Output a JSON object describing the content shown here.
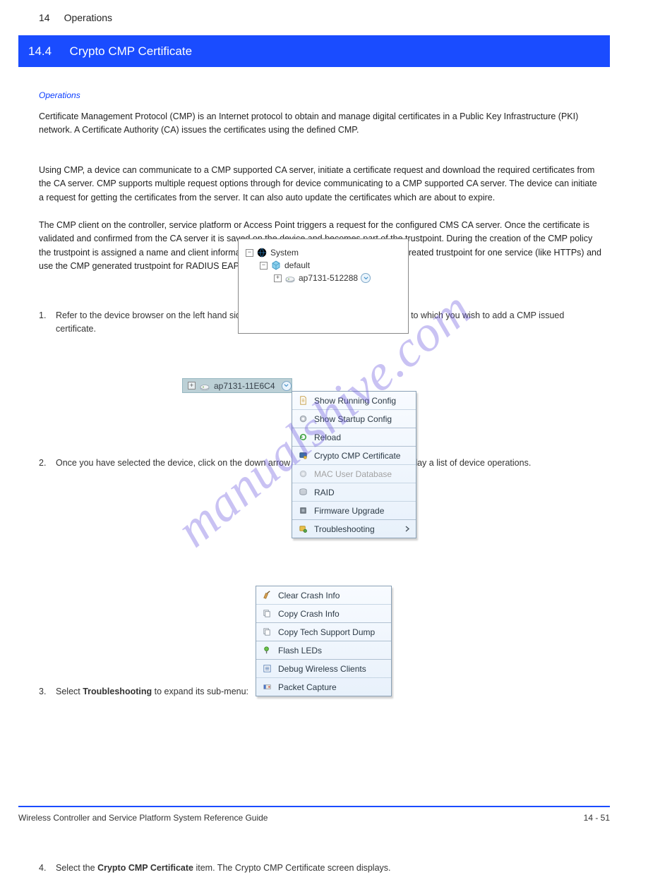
{
  "chapter": {
    "num": "14",
    "title": "Operations"
  },
  "section": {
    "num": "14.4",
    "title": "Crypto CMP Certificate",
    "parent_italic": "Operations"
  },
  "para1": "Certificate Management Protocol (CMP) is an Internet protocol to obtain and manage digital certificates in a Public Key Infrastructure (PKI) network. A Certificate Authority (CA) issues the certificates using the defined CMP.",
  "para2": "Using CMP, a device can communicate to a CMP supported CA server, initiate a certificate request and download the required certificates from the CA server. CMP supports multiple request options through for device communicating to a CMP supported CA server. The device can initiate a request for getting the certificates from the server. It can also auto update the certificates which are about to expire.",
  "steps_head": "The CMP client on the controller, service platform or Access Point triggers a request for the configured CMS CA server. Once the certificate is validated and confirmed from the CA server it is saved on the device and becomes part of the trustpoint. During the creation of the CMP policy the trustpoint is assigned a name and client information. An administrator can use a manually created trustpoint for one service (like HTTPs) and use the CMP generated trustpoint for RADIUS EAP certificate based authentication.",
  "steps": {
    "s1": "Refer to the device browser on the left hand side of the screen and drill down to the device to which you wish to add a CMP issued certificate.",
    "s2": "Once you have selected the device, click on the down arrow to the right of the device to display a list of device operations.",
    "s3_a": "Select ",
    "s3_b": "Troubleshooting",
    "s3_c": " to expand its sub-menu:",
    "s4_a": "Select the ",
    "s4_b": "Crypto CMP Certificate",
    "s4_c": " item. The Crypto CMP Certificate screen displays."
  },
  "tree": {
    "system": "System",
    "default": "default",
    "device": "ap7131-512288"
  },
  "sel_device": "ap7131-11E6C4",
  "menu1": {
    "i1": "Show Running Config",
    "i2": "Show Startup Config",
    "i3": "Reload",
    "i4": "Crypto CMP Certificate",
    "i5": "MAC User Database",
    "i6": "RAID",
    "i7": "Firmware Upgrade",
    "i8": "Troubleshooting"
  },
  "menu2": {
    "i1": "Clear Crash Info",
    "i2": "Copy Crash Info",
    "i3": "Copy Tech Support Dump",
    "i4": "Flash LEDs",
    "i5": "Debug Wireless Clients",
    "i6": "Packet Capture"
  },
  "footer": {
    "left": "Wireless Controller and Service Platform System Reference Guide",
    "right": "14 - 51"
  },
  "watermark": "manualshive.com"
}
